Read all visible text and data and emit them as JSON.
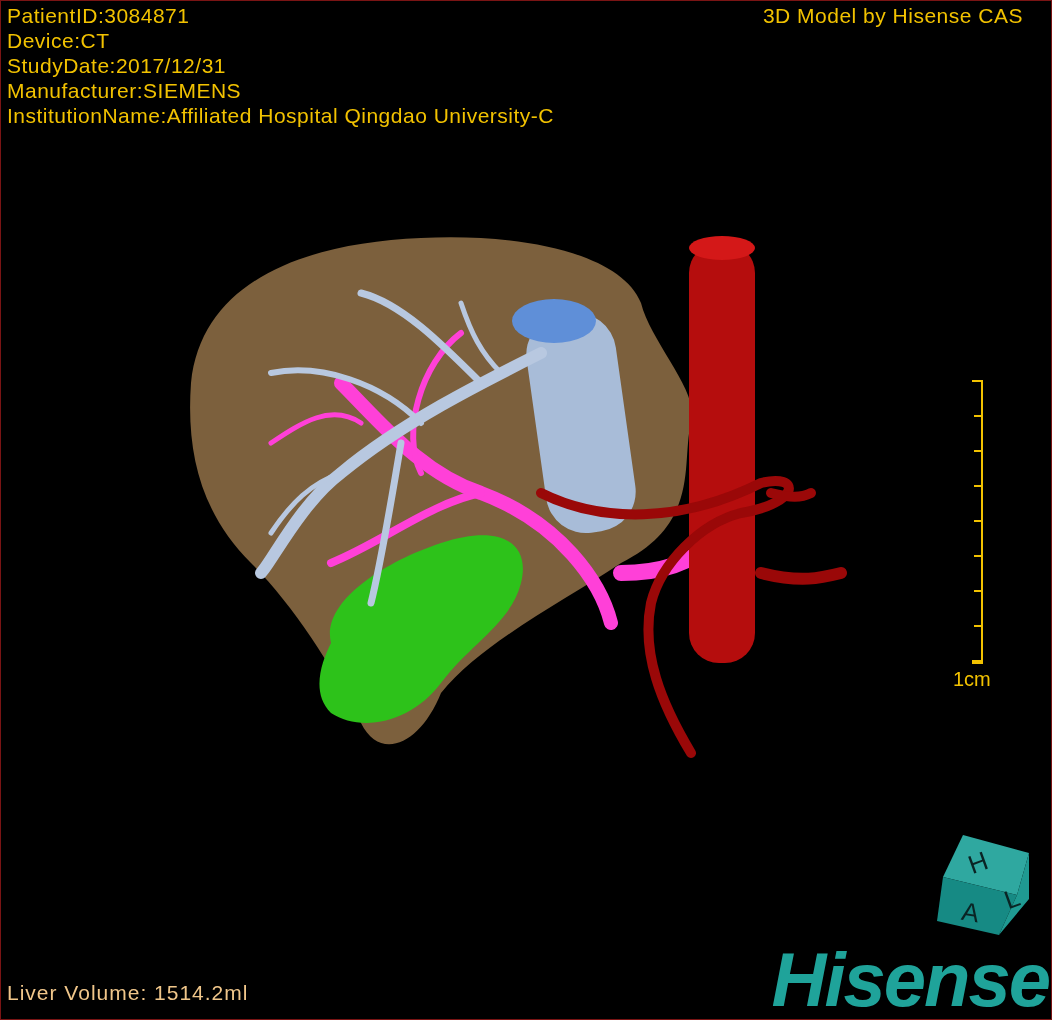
{
  "viewer": {
    "info_lines": [
      "PatientID:3084871",
      "Device:CT",
      "StudyDate:2017/12/31",
      "Manufacturer:SIEMENS",
      "InstitutionName:Affiliated Hospital Qingdao University-C"
    ],
    "title": "3D Model by Hisense CAS",
    "scale_bar": {
      "label": "1cm"
    },
    "liver_volume": "Liver Volume: 1514.2ml",
    "orientation_cube": {
      "faces": [
        "H",
        "A",
        "L"
      ]
    },
    "logo": "Hisense"
  }
}
